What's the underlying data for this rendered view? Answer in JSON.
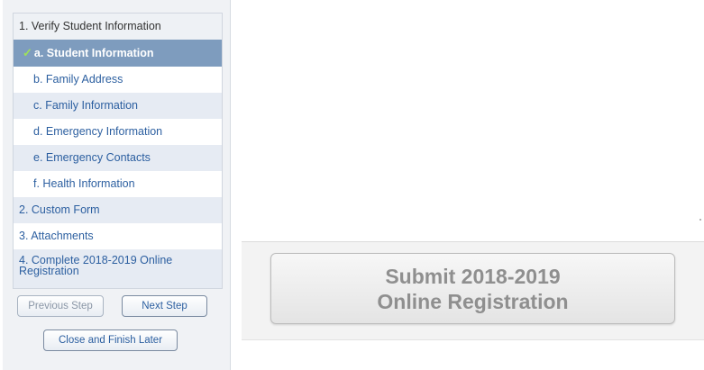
{
  "wizard": {
    "steps": [
      {
        "label": "1. Verify Student Information"
      },
      {
        "label": "a. Student Information"
      },
      {
        "label": "b. Family Address"
      },
      {
        "label": "c. Family Information"
      },
      {
        "label": "d. Emergency Information"
      },
      {
        "label": "e. Emergency Contacts"
      },
      {
        "label": "f. Health Information"
      },
      {
        "label": "2. Custom Form"
      },
      {
        "label": "3. Attachments"
      },
      {
        "label": "4. Complete 2018-2019 Online Registration"
      }
    ],
    "check_glyph": "✓",
    "previous_label": "Previous Step",
    "next_label": "Next Step",
    "close_label": "Close and Finish Later"
  },
  "main": {
    "submit_label": "Submit 2018-2019 Online Registration"
  }
}
